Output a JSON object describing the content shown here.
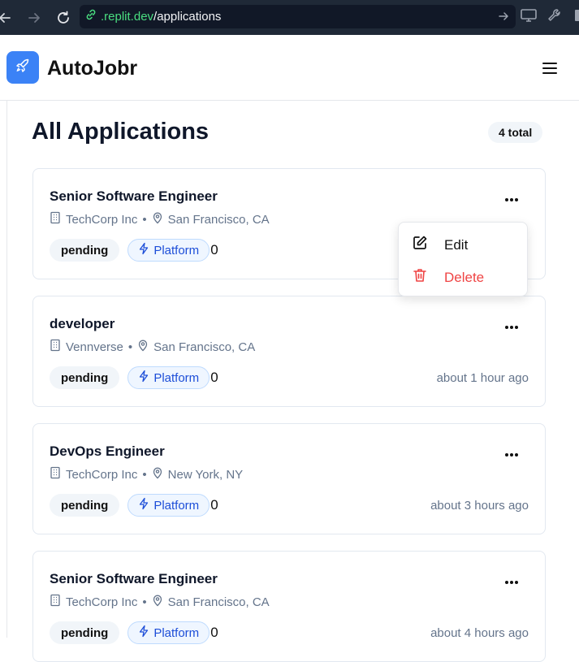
{
  "browser": {
    "url_host": ".replit.dev",
    "url_path": "/applications"
  },
  "header": {
    "brand": "AutoJobr"
  },
  "page": {
    "title": "All Applications",
    "total_badge": "4 total"
  },
  "applications": [
    {
      "title": "Senior Software Engineer",
      "company": "TechCorp Inc",
      "location": "San Francisco, CA",
      "status": "pending",
      "platform": "Platform",
      "count": "0",
      "time": ""
    },
    {
      "title": "developer",
      "company": "Vennverse",
      "location": "San Francisco, CA",
      "status": "pending",
      "platform": "Platform",
      "count": "0",
      "time": "about 1 hour ago"
    },
    {
      "title": "DevOps Engineer",
      "company": "TechCorp Inc",
      "location": "New York, NY",
      "status": "pending",
      "platform": "Platform",
      "count": "0",
      "time": "about 3 hours ago"
    },
    {
      "title": "Senior Software Engineer",
      "company": "TechCorp Inc",
      "location": "San Francisco, CA",
      "status": "pending",
      "platform": "Platform",
      "count": "0",
      "time": "about 4 hours ago"
    }
  ],
  "menu": {
    "edit": "Edit",
    "delete": "Delete"
  },
  "colors": {
    "brand": "#3b82f6",
    "danger": "#ef4444",
    "platform_text": "#1d4ed8"
  },
  "icons": [
    "back-arrow-icon",
    "forward-arrow-icon",
    "reload-icon",
    "link-icon",
    "go-arrow-icon",
    "monitor-icon",
    "wrench-icon",
    "rocket-icon",
    "hamburger-menu-icon",
    "building-icon",
    "map-pin-icon",
    "lightning-icon",
    "more-dots-icon",
    "edit-icon",
    "trash-icon"
  ]
}
